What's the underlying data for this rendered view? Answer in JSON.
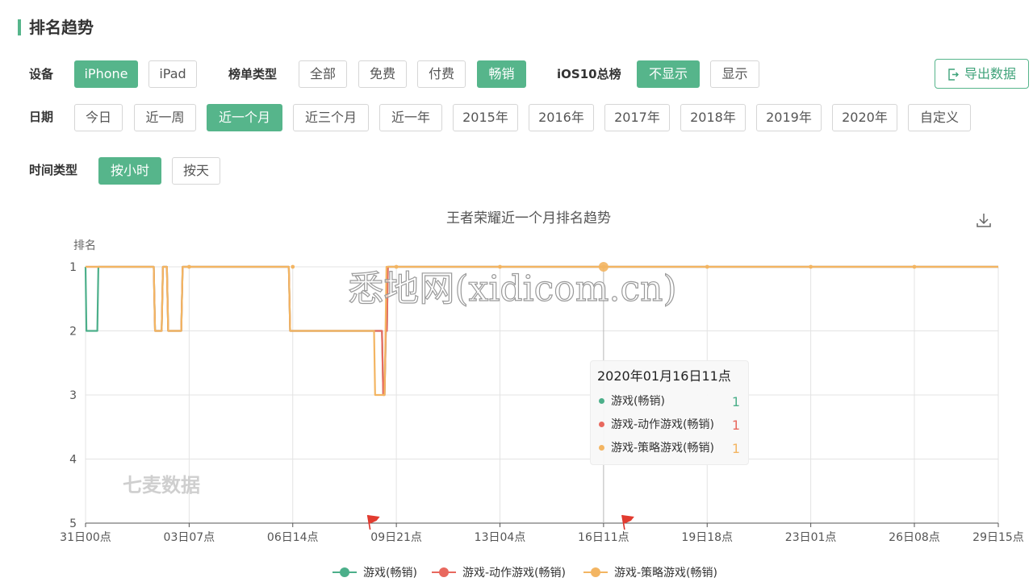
{
  "section_title": "排名趋势",
  "filters": {
    "device": {
      "label": "设备",
      "options": [
        "iPhone",
        "iPad"
      ],
      "active": 0
    },
    "list_type": {
      "label": "榜单类型",
      "options": [
        "全部",
        "免费",
        "付费",
        "畅销"
      ],
      "active": 3
    },
    "ios10": {
      "label": "iOS10总榜",
      "options": [
        "不显示",
        "显示"
      ],
      "active": 0
    },
    "date": {
      "label": "日期",
      "options": [
        "今日",
        "近一周",
        "近一个月",
        "近三个月",
        "近一年",
        "2015年",
        "2016年",
        "2017年",
        "2018年",
        "2019年",
        "2020年",
        "自定义"
      ],
      "active": 2
    },
    "time_type": {
      "label": "时间类型",
      "options": [
        "按小时",
        "按天"
      ],
      "active": 0
    }
  },
  "export_label": "导出数据",
  "icons": {
    "export": "export-icon",
    "download": "download-icon",
    "flag": "flag-icon"
  },
  "watermark_brand": "七麦数据",
  "watermark_site": "悉地网(xidicom.cn)",
  "tooltip": {
    "title": "2020年01月16日11点",
    "rows": [
      {
        "name": "游戏(畅销)",
        "value": "1",
        "color": "#4caf8a"
      },
      {
        "name": "游戏-动作游戏(畅销)",
        "value": "1",
        "color": "#e8685e"
      },
      {
        "name": "游戏-策略游戏(畅销)",
        "value": "1",
        "color": "#f3b562"
      }
    ]
  },
  "chart_data": {
    "type": "line",
    "title": "王者荣耀近一个月排名趋势",
    "ylabel": "排名",
    "ylim": [
      1,
      5
    ],
    "y_inverted": true,
    "y_ticks": [
      1,
      2,
      3,
      4,
      5
    ],
    "xlim_hours": [
      0,
      696
    ],
    "x_ticks": [
      {
        "label": "31日00点",
        "hour": 0
      },
      {
        "label": "03日07点",
        "hour": 79
      },
      {
        "label": "06日14点",
        "hour": 158
      },
      {
        "label": "09日21点",
        "hour": 237
      },
      {
        "label": "13日04点",
        "hour": 316
      },
      {
        "label": "16日11点",
        "hour": 395
      },
      {
        "label": "19日18点",
        "hour": 474
      },
      {
        "label": "23日01点",
        "hour": 553
      },
      {
        "label": "26日08点",
        "hour": 632
      },
      {
        "label": "29日15点",
        "hour": 711
      }
    ],
    "grid": true,
    "legend_position": "bottom",
    "highlight_hour": 395,
    "flag_hours": [
      217,
      411
    ],
    "series": [
      {
        "name": "游戏(畅销)",
        "color": "#4caf8a",
        "points": [
          [
            0,
            1
          ],
          [
            0.7,
            2
          ],
          [
            9,
            2
          ],
          [
            9.8,
            1
          ],
          [
            52,
            1
          ],
          [
            53,
            2
          ],
          [
            58,
            2
          ],
          [
            59,
            1
          ],
          [
            62,
            1
          ],
          [
            63,
            2
          ],
          [
            73,
            2
          ],
          [
            74,
            1
          ],
          [
            155,
            1
          ],
          [
            156,
            2
          ],
          [
            226,
            2
          ],
          [
            227,
            3
          ],
          [
            228,
            3
          ],
          [
            229,
            2
          ],
          [
            229.8,
            2
          ],
          [
            230.5,
            1
          ],
          [
            711,
            1
          ]
        ]
      },
      {
        "name": "游戏-动作游戏(畅销)",
        "color": "#e8685e",
        "points": [
          [
            0,
            1
          ],
          [
            52,
            1
          ],
          [
            53,
            2
          ],
          [
            58,
            2
          ],
          [
            59,
            1
          ],
          [
            62,
            1
          ],
          [
            63,
            2
          ],
          [
            73,
            2
          ],
          [
            74,
            1
          ],
          [
            155,
            1
          ],
          [
            156,
            2
          ],
          [
            226,
            2
          ],
          [
            227,
            3
          ],
          [
            228,
            3
          ],
          [
            229,
            2
          ],
          [
            229.8,
            2
          ],
          [
            230.5,
            1
          ],
          [
            711,
            1
          ]
        ]
      },
      {
        "name": "游戏-策略游戏(畅销)",
        "color": "#f3b562",
        "points": [
          [
            0,
            1
          ],
          [
            52,
            1
          ],
          [
            53,
            2
          ],
          [
            58,
            2
          ],
          [
            59,
            1
          ],
          [
            62,
            1
          ],
          [
            63,
            2
          ],
          [
            73,
            2
          ],
          [
            74,
            1
          ],
          [
            155,
            1
          ],
          [
            156,
            2
          ],
          [
            220,
            2
          ],
          [
            220.8,
            3
          ],
          [
            228,
            3
          ],
          [
            229.5,
            1
          ],
          [
            711,
            1
          ]
        ]
      }
    ]
  }
}
